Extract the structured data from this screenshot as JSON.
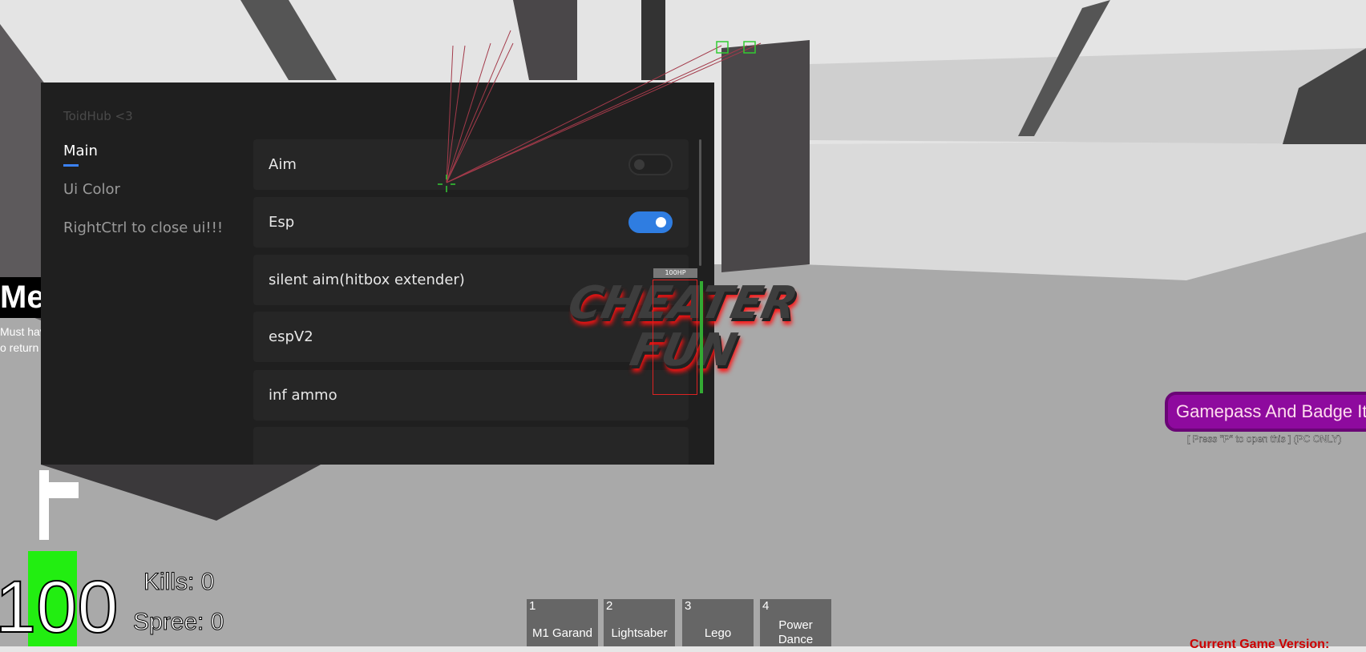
{
  "ui": {
    "title": "ToidHub <3",
    "nav": [
      {
        "label": "Main",
        "active": true
      },
      {
        "label": "Ui Color",
        "active": false
      },
      {
        "label": "RightCtrl to close ui!!!",
        "active": false
      }
    ],
    "rows": [
      {
        "label": "Aim",
        "toggle": false
      },
      {
        "label": "Esp",
        "toggle": true
      },
      {
        "label": "silent aim(hitbox extender)"
      },
      {
        "label": "espV2"
      },
      {
        "label": "inf ammo"
      },
      {
        "label": ""
      }
    ],
    "accent": "#2f7de1"
  },
  "esp": {
    "hp_label": "100HP"
  },
  "logo": {
    "text1": "CHEATER",
    "text2": "FUN"
  },
  "left_sign": {
    "title": "Me",
    "line1": "Must hav",
    "line2": "o return l"
  },
  "hud": {
    "health": "100",
    "kills": "Kills: 0",
    "spree": "Spree: 0",
    "health_color": "#22ee11"
  },
  "hotbar": [
    {
      "num": "1",
      "name": "M1 Garand"
    },
    {
      "num": "2",
      "name": "Lightsaber"
    },
    {
      "num": "3",
      "name": "Lego"
    },
    {
      "num": "4",
      "name": "Power Dance"
    }
  ],
  "gamepass": {
    "label": "Gamepass And Badge Item",
    "hint": "[ Press \"P\" to open this ] (PC ONLY)",
    "color": "#8e0a9e"
  },
  "version": {
    "label": "Current Game Version:"
  }
}
